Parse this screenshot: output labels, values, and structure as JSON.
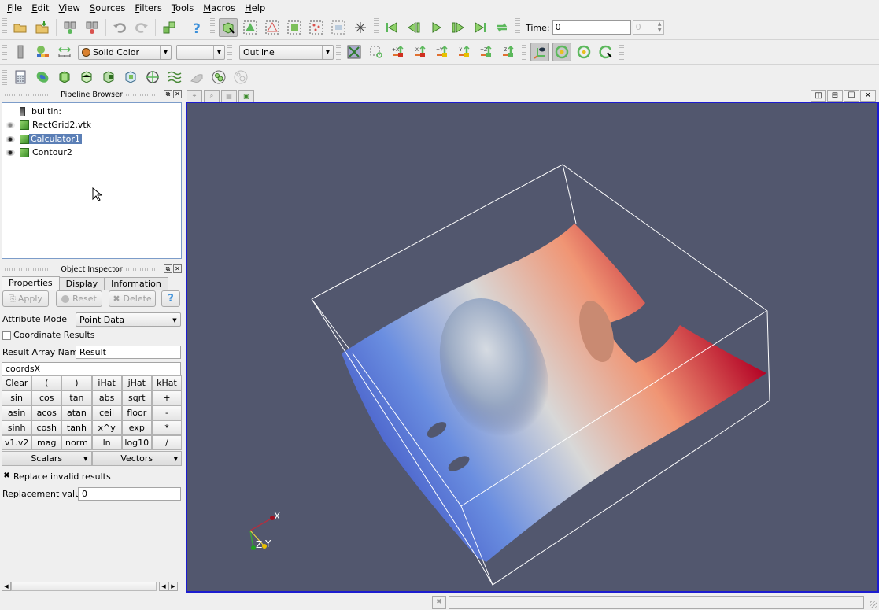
{
  "menu": [
    {
      "key": "F",
      "rest": "ile"
    },
    {
      "key": "E",
      "rest": "dit"
    },
    {
      "key": "V",
      "rest": "iew"
    },
    {
      "key": "S",
      "rest": "ources"
    },
    {
      "key": "F",
      "rest": "ilters"
    },
    {
      "key": "T",
      "rest": "ools"
    },
    {
      "key": "M",
      "rest": "acros"
    },
    {
      "key": "H",
      "rest": "elp"
    }
  ],
  "toolbar": {
    "time_label": "Time:",
    "time_value": "0",
    "timestep_value": "0",
    "color_by": "Solid Color",
    "component": "",
    "representation": "Outline",
    "camera_buttons": [
      "+X",
      "-X",
      "+Y",
      "-Y",
      "+Z",
      "-Z"
    ]
  },
  "pipeline": {
    "title": "Pipeline Browser",
    "items": [
      {
        "label": "builtin:",
        "type": "server"
      },
      {
        "label": "RectGrid2.vtk",
        "type": "source",
        "visible": false
      },
      {
        "label": "Calculator1",
        "type": "filter",
        "visible": true,
        "selected": true
      },
      {
        "label": "Contour2",
        "type": "filter",
        "visible": true
      }
    ]
  },
  "inspector": {
    "title": "Object Inspector",
    "tabs": [
      "Properties",
      "Display",
      "Information"
    ],
    "active_tab": "Properties",
    "apply_label": "Apply",
    "reset_label": "Reset",
    "delete_label": "Delete",
    "help_label": "?",
    "attribute_mode_label": "Attribute Mode",
    "attribute_mode_value": "Point Data",
    "coordinate_results_label": "Coordinate Results",
    "coordinate_results_checked": false,
    "result_array_label": "Result Array Name",
    "result_array_value": "Result",
    "expression": "coordsX",
    "calc_rows": [
      [
        "Clear",
        "(",
        ")",
        "iHat",
        "jHat",
        "kHat"
      ],
      [
        "sin",
        "cos",
        "tan",
        "abs",
        "sqrt",
        "+"
      ],
      [
        "asin",
        "acos",
        "atan",
        "ceil",
        "floor",
        "-"
      ],
      [
        "sinh",
        "cosh",
        "tanh",
        "x^y",
        "exp",
        "*"
      ],
      [
        "v1.v2",
        "mag",
        "norm",
        "ln",
        "log10",
        "/"
      ]
    ],
    "scalars_label": "Scalars",
    "vectors_label": "Vectors",
    "replace_invalid_label": "Replace invalid results",
    "replace_invalid_checked": true,
    "replacement_value_label": "Replacement value",
    "replacement_value": "0"
  },
  "view": {
    "background": "#52576e",
    "border_color": "#1c1ccf",
    "axes_labels": {
      "x": "X",
      "y": "Y",
      "z": "Z"
    },
    "colormap": [
      "#3b4cc0",
      "#8caef0",
      "#dddcdc",
      "#f49a7b",
      "#b40426"
    ]
  }
}
